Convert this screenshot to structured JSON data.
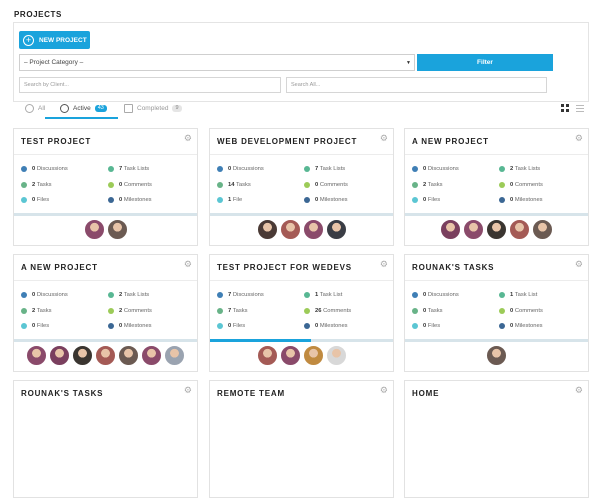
{
  "page": {
    "title": "PROJECTS"
  },
  "toolbar": {
    "new_project_label": "NEW PROJECT",
    "category_select": "– Project Category –",
    "filter_label": "Filter",
    "search_client_placeholder": "Search by Client...",
    "search_all_placeholder": "Search All..."
  },
  "tabs": [
    {
      "label": "All",
      "count": ""
    },
    {
      "label": "Active",
      "count": "43"
    },
    {
      "label": "Completed",
      "count": "9"
    }
  ],
  "colors": {
    "accent": "#1aa3dc",
    "discussions": "#3f7fb5",
    "tasklists": "#58b793",
    "tasks": "#68b388",
    "comments": "#9ccb58",
    "files": "#5bc6d3",
    "milestones": "#3b6794"
  },
  "projects": [
    {
      "title": "TEST PROJECT",
      "discussions": "0",
      "task_lists": "7",
      "tasks": "2",
      "comments": "0",
      "files": "0",
      "milestones": "0",
      "progress": 0,
      "avatars": [
        "#8a4a6a",
        "#6b5a52"
      ]
    },
    {
      "title": "WEB DEVELOPMENT PROJECT",
      "discussions": "0",
      "task_lists": "7",
      "tasks": "14",
      "comments": "0",
      "files": "1",
      "milestones": "0",
      "progress": 0,
      "avatars": [
        "#4a3a35",
        "#a45a55",
        "#8a4a6a",
        "#3a3d45"
      ]
    },
    {
      "title": "A NEW PROJECT",
      "discussions": "0",
      "task_lists": "2",
      "tasks": "2",
      "comments": "0",
      "files": "0",
      "milestones": "0",
      "progress": 0,
      "avatars": [
        "#7a3f5e",
        "#8a4a6a",
        "#3a3530",
        "#a45a55",
        "#6b5a52"
      ]
    },
    {
      "title": "A NEW PROJECT",
      "discussions": "0",
      "task_lists": "2",
      "tasks": "2",
      "comments": "2",
      "files": "0",
      "milestones": "0",
      "progress": 0,
      "avatars": [
        "#8a4a6a",
        "#7a3f5e",
        "#3a3530",
        "#a45a55",
        "#6b5a52",
        "#8a4a6a",
        "#9aa3b0"
      ]
    },
    {
      "title": "TEST PROJECT FOR WEDEVS",
      "discussions": "7",
      "task_lists": "1",
      "tasks": "7",
      "comments": "26",
      "files": "0",
      "milestones": "0",
      "progress": 0.55,
      "avatars": [
        "#a45a55",
        "#8a4a6a",
        "#c08a40",
        "#d8d8d8"
      ]
    },
    {
      "title": "ROUNAK'S TASKS",
      "discussions": "0",
      "task_lists": "1",
      "tasks": "0",
      "comments": "0",
      "files": "0",
      "milestones": "0",
      "progress": 0,
      "avatars": [
        "#6b5a52"
      ]
    },
    {
      "title": "ROUNAK'S TASKS"
    },
    {
      "title": "REMOTE TEAM"
    },
    {
      "title": "HOME"
    }
  ],
  "labels": {
    "discussions": "Discussions",
    "task_lists": "Task Lists",
    "task_list": "Task List",
    "tasks": "Tasks",
    "comments": "Comments",
    "files": "Files",
    "file": "File",
    "milestones": "Milestones"
  }
}
